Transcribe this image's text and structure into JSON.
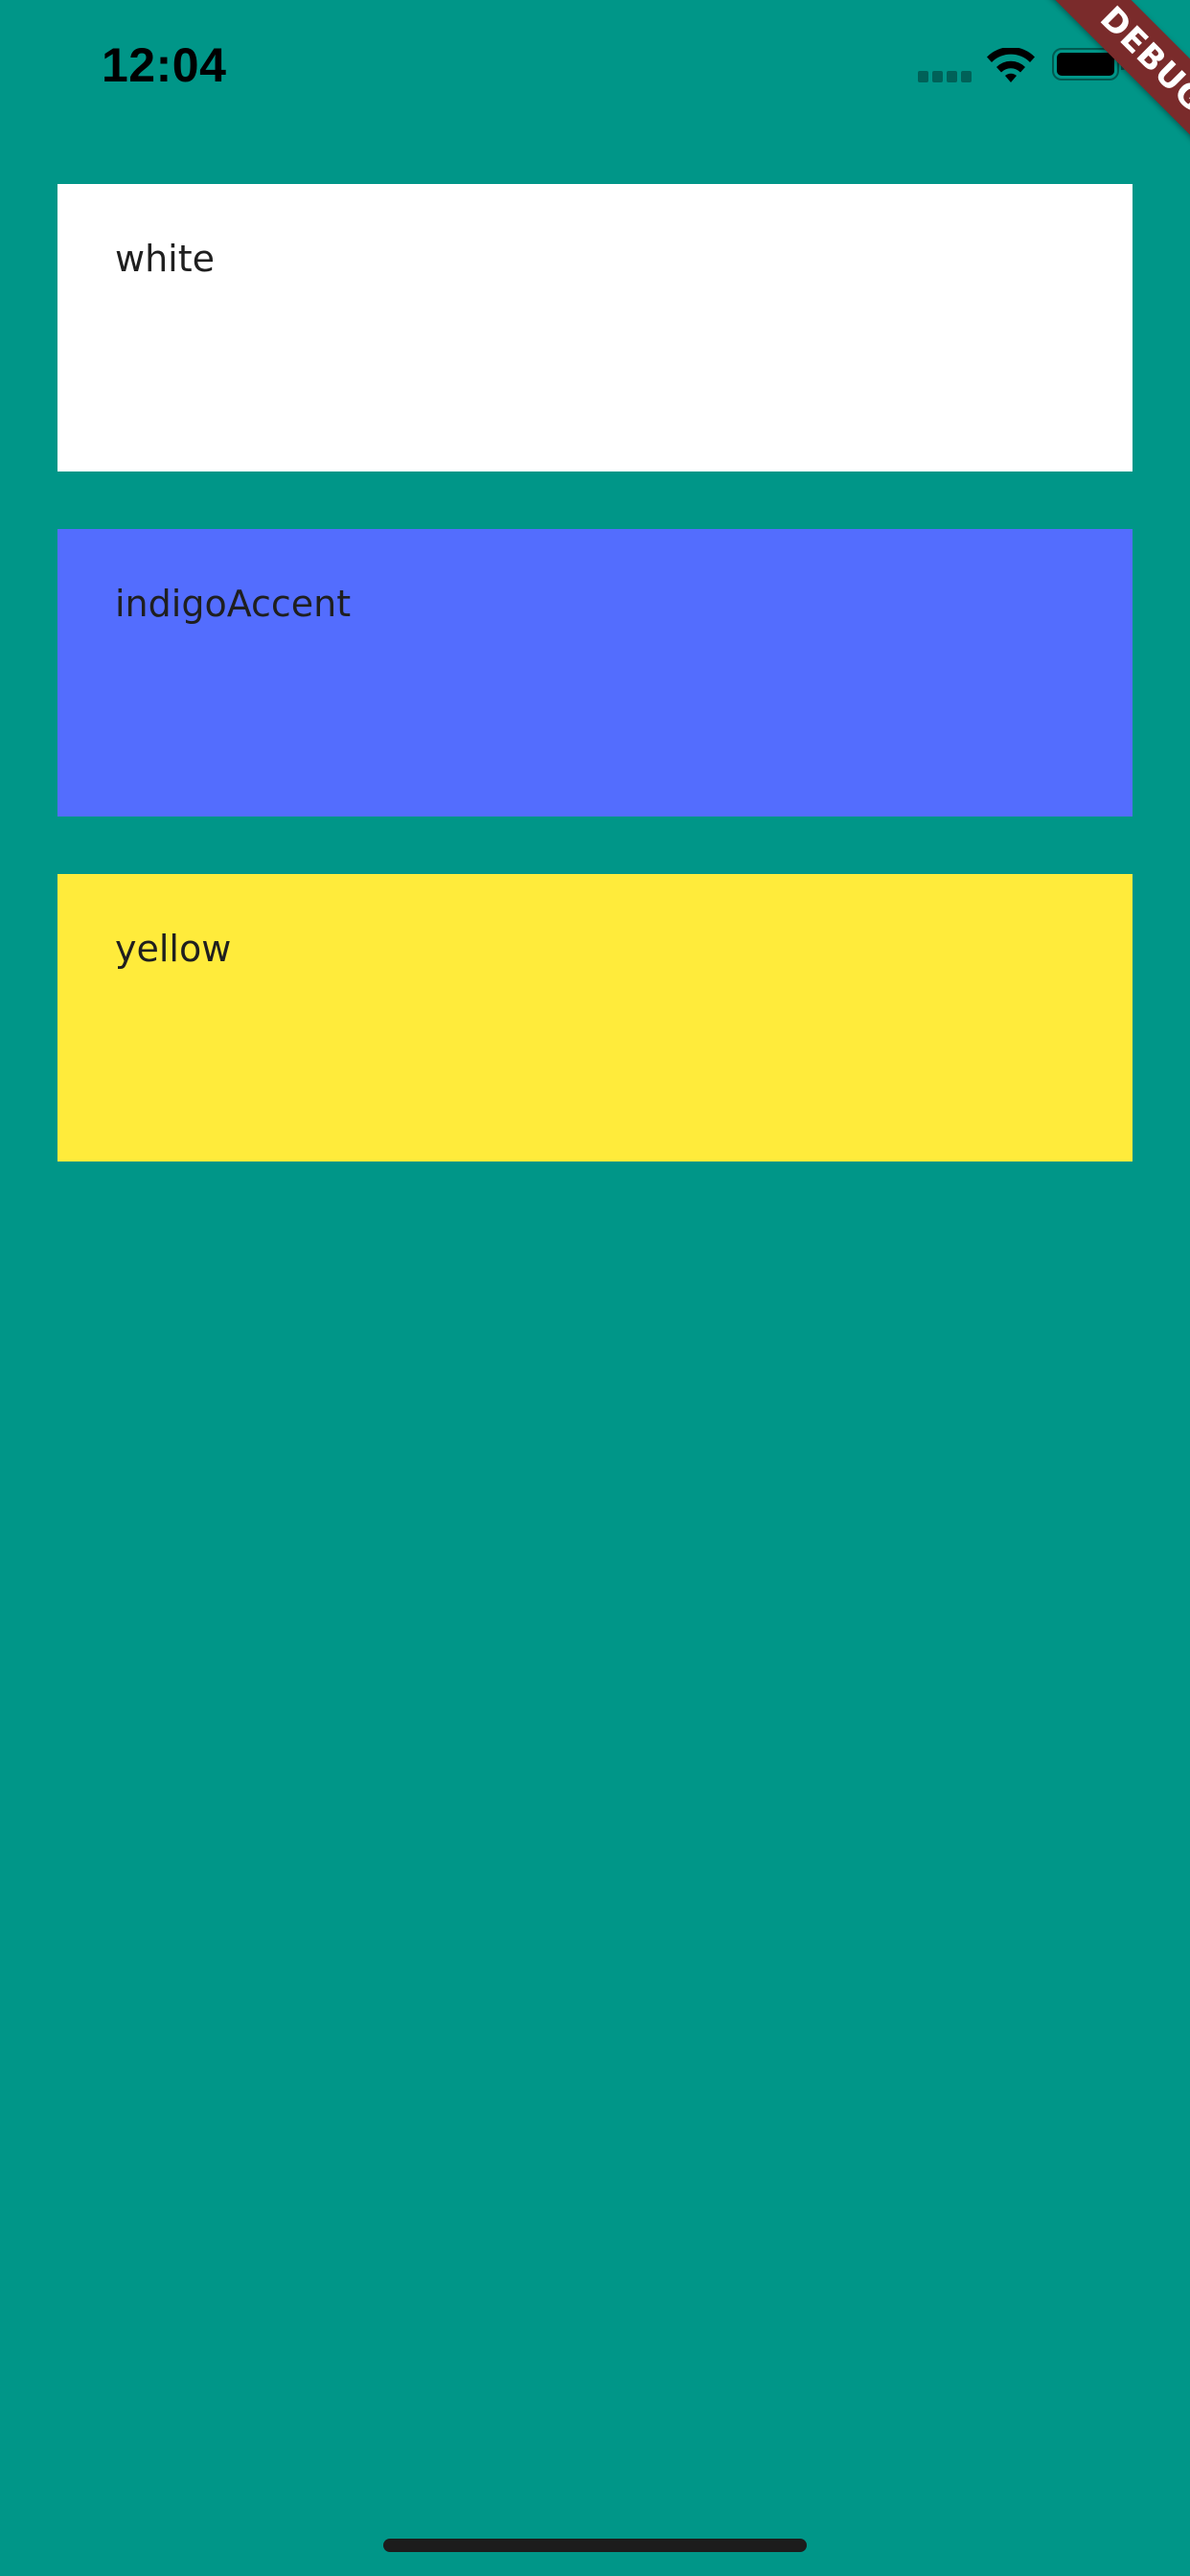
{
  "colors": {
    "background": "#009688",
    "status_text": "#000000",
    "debug_banner": "#7a2b2b",
    "debug_text": "#ffffff",
    "label_text": "#1f1f1f",
    "home_indicator": "#1c1c1c"
  },
  "status_bar": {
    "time": "12:04",
    "icons": [
      "cellular-signal-icon",
      "wifi-icon",
      "battery-icon"
    ]
  },
  "debug_banner": {
    "label": "DEBUG"
  },
  "cards": [
    {
      "label": "white",
      "color": "#ffffff"
    },
    {
      "label": "indigoAccent",
      "color": "#536dfe"
    },
    {
      "label": "yellow",
      "color": "#ffeb3b"
    }
  ]
}
